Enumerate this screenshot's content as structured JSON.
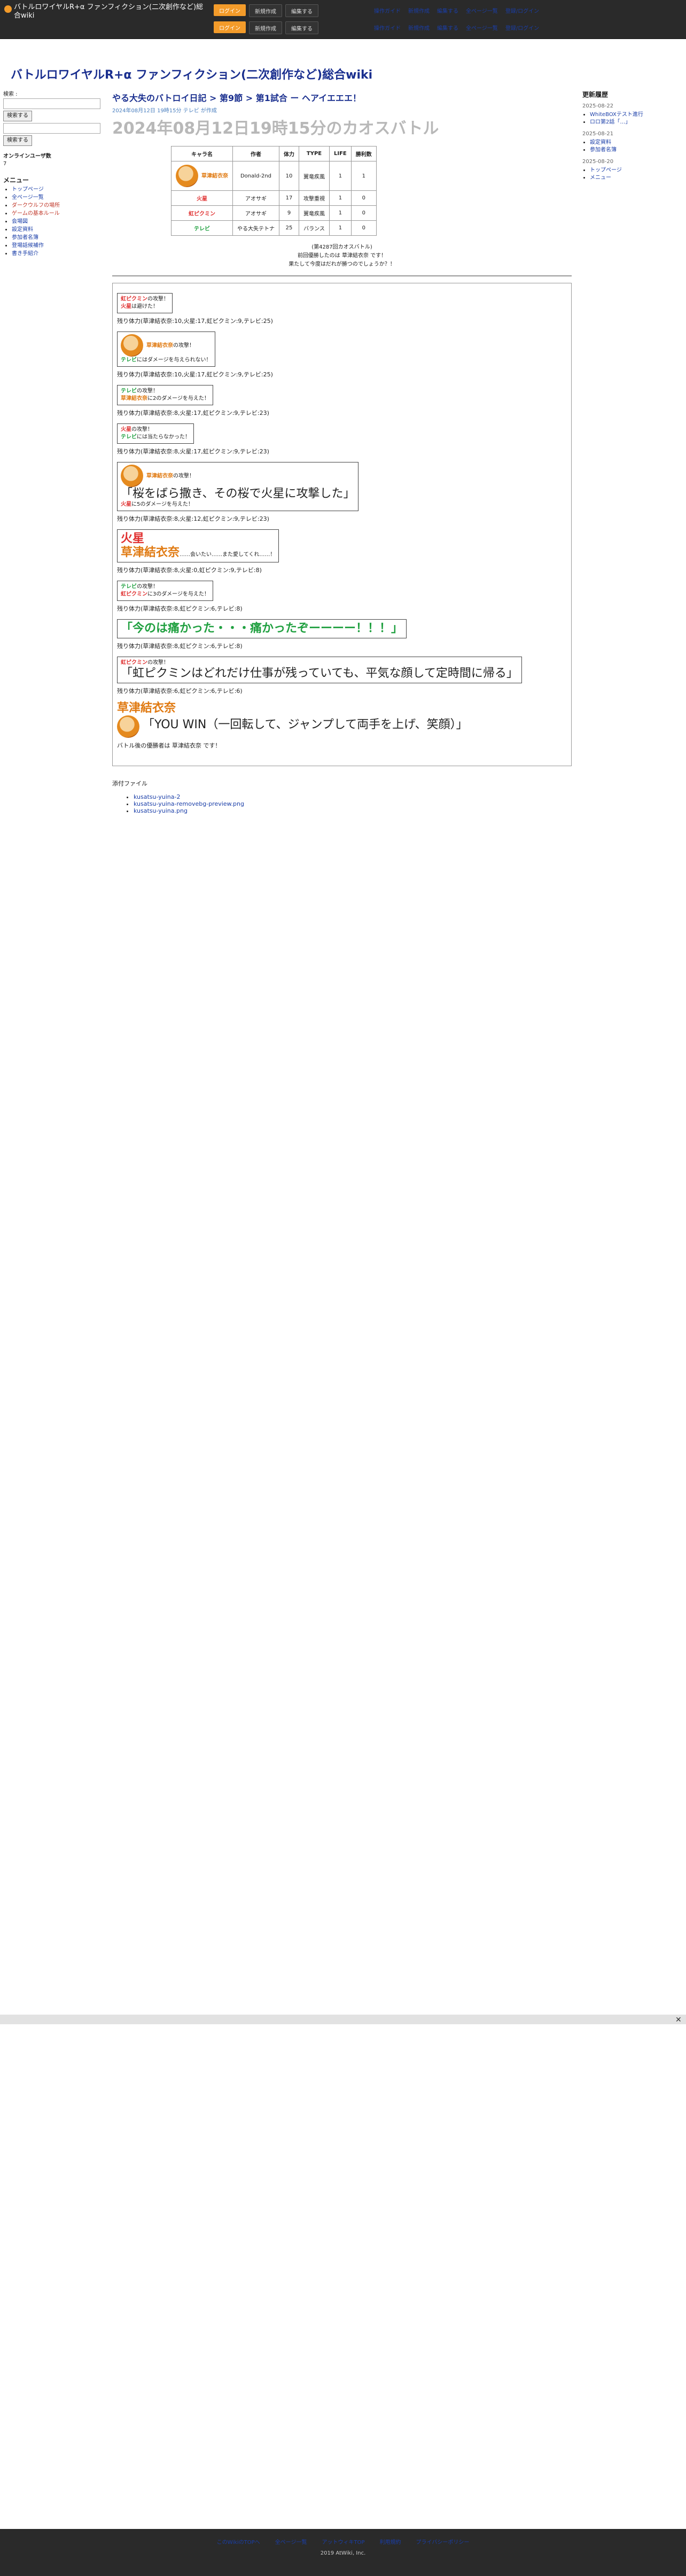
{
  "header": {
    "site_name": "バトルロワイヤルR+α ファンフィクション(二次創作など)総合wiki",
    "buttons": [
      "ログイン",
      "新規作成",
      "編集する"
    ],
    "nav": [
      "操作ガイド",
      "新規作成",
      "編集する",
      "全ページ一覧",
      "登録/ログイン"
    ]
  },
  "page_title": "バトルロワイヤルR+α ファンフィクション(二次創作など)総合wiki",
  "left": {
    "search_label": "検索 :",
    "search_button": "検索する",
    "online_label": "オンラインユーザ数",
    "online_count": "7",
    "menu_title": "メニュー",
    "menu_items": [
      "トップページ",
      "全ページ一覧",
      "ダークウルフの場所",
      "ゲームの基本ルール",
      "会場図",
      "設定資料",
      "参加者名簿",
      "登場話候補作",
      "書き手紹介"
    ]
  },
  "right": {
    "title": "更新履歴",
    "entries": [
      {
        "date": "2025-08-22",
        "items": [
          "WhiteBOXテスト進行",
          "ロロ第2話「…」"
        ]
      },
      {
        "date": "2025-08-21",
        "items": [
          "設定資料",
          "参加者名簿"
        ]
      },
      {
        "date": "2025-08-20",
        "items": [
          "トップページ",
          "メニュー"
        ]
      }
    ]
  },
  "main": {
    "breadcrumb": "やる大失のバトロイ日記 > 第9節 > 第1試合 ー ヘアイエエエ！",
    "meta": "2024年08月12日 19時15分 テレビ が作成",
    "heading": "2024年08月12日19時15分のカオスバトル",
    "table": {
      "headers": [
        "キャラ名",
        "作者",
        "体力",
        "TYPE",
        "LIFE",
        "勝利数"
      ],
      "rows": [
        [
          "草津結衣奈",
          "Donald-2nd",
          "10",
          "翼竜疾風",
          "1",
          "1"
        ],
        [
          "火星",
          "アオサギ",
          "17",
          "攻撃重視",
          "1",
          "0"
        ],
        [
          "虹ピクミン",
          "アオサギ",
          "9",
          "翼竜疾風",
          "1",
          "0"
        ],
        [
          "テレビ",
          "やる大失テトナ",
          "25",
          "バランス",
          "1",
          "0"
        ]
      ]
    },
    "note1": "(第4287回カオスバトル)",
    "note2": "前回優勝したのは 草津結衣奈 です！",
    "note3": "果たして今度はだれが勝つのでしょうか？！",
    "rounds": [
      {
        "line": "残り体力(草津結衣奈:10,火星:17,虹ピクミン:9,テレビ:25)"
      },
      {
        "line": "残り体力(草津結衣奈:10,火星:17,虹ピクミン:9,テレビ:25)"
      },
      {
        "line": "残り体力(草津結衣奈:8,火星:17,虹ピクミン:9,テレビ:23)"
      },
      {
        "line": "残り体力(草津結衣奈:8,火星:17,虹ピクミン:9,テレビ:23)"
      },
      {
        "line": "残り体力(草津結衣奈:8,火星:12,虹ピクミン:9,テレビ:23)"
      },
      {
        "line": "残り体力(草津結衣奈:8,火星:0,虹ピクミン:9,テレビ:8)"
      },
      {
        "line": "残り体力(草津結衣奈:8,虹ピクミン:6,テレビ:8)"
      },
      {
        "line": "残り体力(草津結衣奈:8,虹ピクミン:6,テレビ:8)"
      },
      {
        "line": "残り体力(草津結衣奈:6,虹ピクミン:6,テレビ:6)"
      }
    ],
    "big1": "「桜をばら撒き、その桜で火星に攻撃した」",
    "big2": "「今のは痛かった・・・痛かったぞーーーー！！！」",
    "big3": "「虹ピクミンはどれだけ仕事が残っていても、平気な顔して定時間に帰る」",
    "big4": "「YOU WIN（一回転して、ジャンプして両手を上げ、笑顔）」",
    "winner": "草津結衣奈",
    "end_note": "バトル後の優勝者は 草津結衣奈 です！",
    "files_label": "添付ファイル",
    "files": [
      "kusatsu-yuina-2",
      "kusatsu-yuina-removebg-preview.png",
      "kusatsu-yuina.png"
    ]
  },
  "footer": {
    "links": [
      "このWikiのTOPへ",
      "全ページ一覧",
      "アットウィキTOP",
      "利用規約",
      "プライバシーポリシー"
    ],
    "copy": "2019 AtWiki, Inc."
  }
}
